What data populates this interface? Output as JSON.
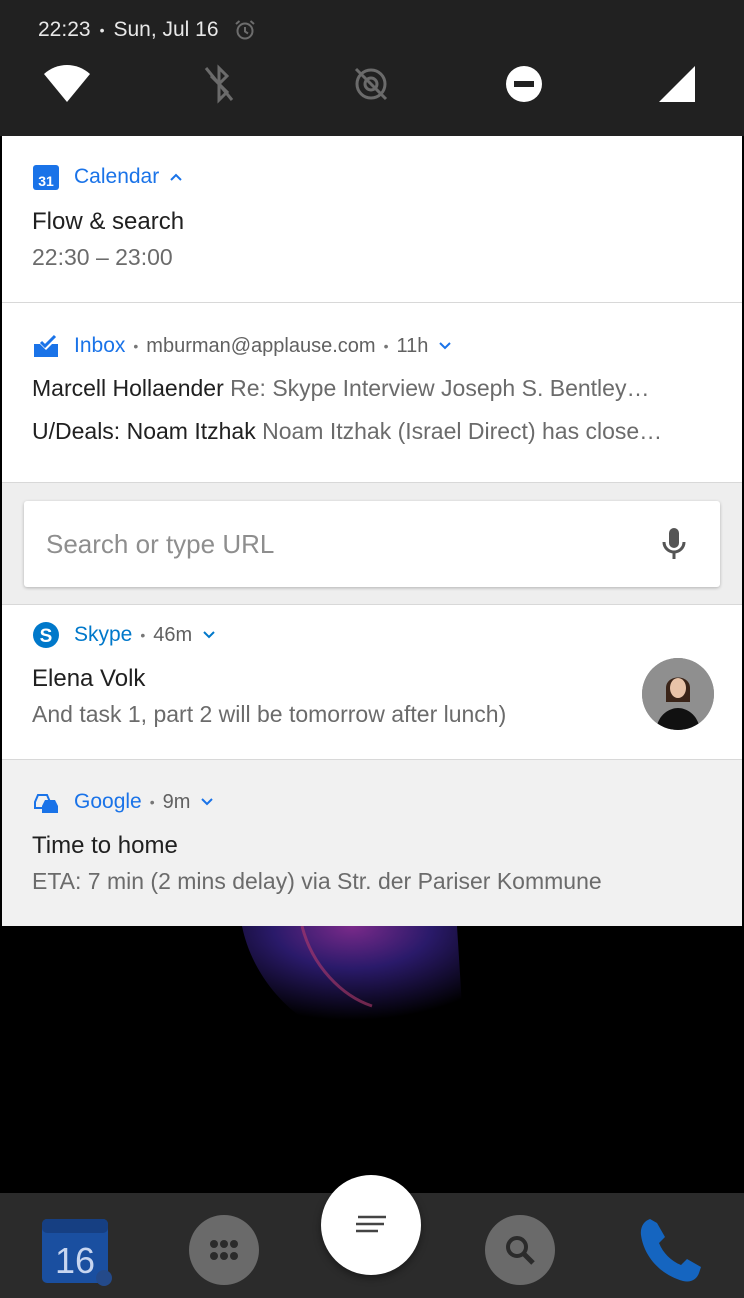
{
  "status_bar": {
    "time": "22:23",
    "date": "Sun, Jul 16",
    "icons": [
      "alarm-icon"
    ]
  },
  "quick_settings": [
    "wifi-icon",
    "bluetooth-off-icon",
    "location-off-icon",
    "do-not-disturb-icon",
    "cell-signal-icon"
  ],
  "notifications": {
    "calendar": {
      "app": "Calendar",
      "icon_day": "31",
      "title": "Flow & search",
      "subtitle": "22:30 – 23:00",
      "accent": "#1a73e8"
    },
    "inbox": {
      "app": "Inbox",
      "account": "mburman@applause.com",
      "time": "11h",
      "messages": [
        {
          "sender": "Marcell Hollaender",
          "preview": "Re: Skype Interview Joseph S. Bentley…"
        },
        {
          "sender": "U/Deals: Noam Itzhak",
          "preview": "Noam Itzhak (Israel Direct) has close…"
        }
      ],
      "accent": "#1a73e8"
    },
    "search": {
      "placeholder": "Search or type URL"
    },
    "skype": {
      "app": "Skype",
      "time": "46m",
      "title": "Elena Volk",
      "message": "And task 1, part 2 will be tomorrow after lunch)",
      "accent": "#0078ca"
    },
    "google": {
      "app": "Google",
      "time": "9m",
      "title": "Time to home",
      "message": "ETA: 7 min (2 mins delay) via Str. der Pariser Kommune",
      "accent": "#1a73e8"
    }
  },
  "dock": {
    "calendar_day": "16",
    "items": [
      "calendar-app-icon",
      "app-drawer-icon",
      "search-app-icon",
      "phone-app-icon"
    ]
  }
}
